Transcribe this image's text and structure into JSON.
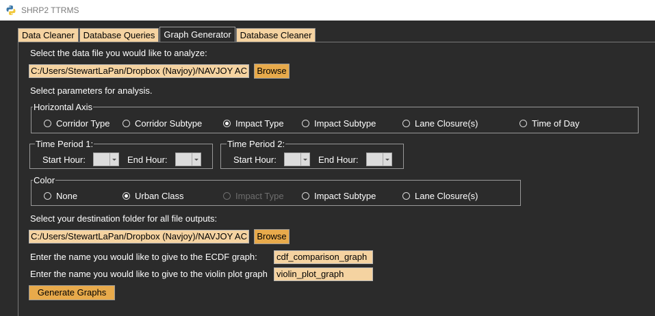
{
  "window": {
    "title": "SHRP2 TTRMS"
  },
  "tabs": [
    {
      "label": "Data Cleaner"
    },
    {
      "label": "Database Queries"
    },
    {
      "label": "Graph Generator"
    },
    {
      "label": "Database Cleaner"
    }
  ],
  "active_tab": "Graph Generator",
  "data_file": {
    "prompt": "Select the data file you would like to analyze:",
    "path": "C:/Users/StewartLaPan/Dropbox (Navjoy)/NAVJOY AC",
    "browse_label": "Browse"
  },
  "params_prompt": "Select parameters for analysis.",
  "horizontal_axis": {
    "title": "Horizontal Axis",
    "options": [
      {
        "label": "Corridor Type",
        "checked": false
      },
      {
        "label": "Corridor Subtype",
        "checked": false
      },
      {
        "label": "Impact Type",
        "checked": true
      },
      {
        "label": "Impact Subtype",
        "checked": false
      },
      {
        "label": "Lane Closure(s)",
        "checked": false
      },
      {
        "label": "Time of Day",
        "checked": false
      }
    ]
  },
  "time_period_1": {
    "title": "Time Period 1:",
    "start_label": "Start Hour:",
    "end_label": "End Hour:",
    "start_value": "",
    "end_value": ""
  },
  "time_period_2": {
    "title": "Time Period 2:",
    "start_label": "Start Hour:",
    "end_label": "End Hour:",
    "start_value": "",
    "end_value": ""
  },
  "color": {
    "title": "Color",
    "options": [
      {
        "label": "None",
        "checked": false,
        "disabled": false
      },
      {
        "label": "Urban Class",
        "checked": true,
        "disabled": false
      },
      {
        "label": "Impact Type",
        "checked": false,
        "disabled": true
      },
      {
        "label": "Impact Subtype",
        "checked": false,
        "disabled": false
      },
      {
        "label": "Lane Closure(s)",
        "checked": false,
        "disabled": false
      }
    ]
  },
  "destination": {
    "prompt": "Select your destination folder for all file outputs:",
    "path": "C:/Users/StewartLaPan/Dropbox (Navjoy)/NAVJOY AC",
    "browse_label": "Browse"
  },
  "ecdf": {
    "prompt": "Enter the name you would like to give to the ECDF graph:",
    "value": "cdf_comparison_graph"
  },
  "violin": {
    "prompt": "Enter the name you would like to give to the violin plot graph",
    "value": "violin_plot_graph"
  },
  "generate_label": "Generate Graphs",
  "colors": {
    "background": "#2b2b2b",
    "tab_inactive": "#f5d3a1",
    "entry_bg": "#f5d3a1",
    "button_bg": "#e8aa4b",
    "disabled_text": "#6e6e6e"
  }
}
